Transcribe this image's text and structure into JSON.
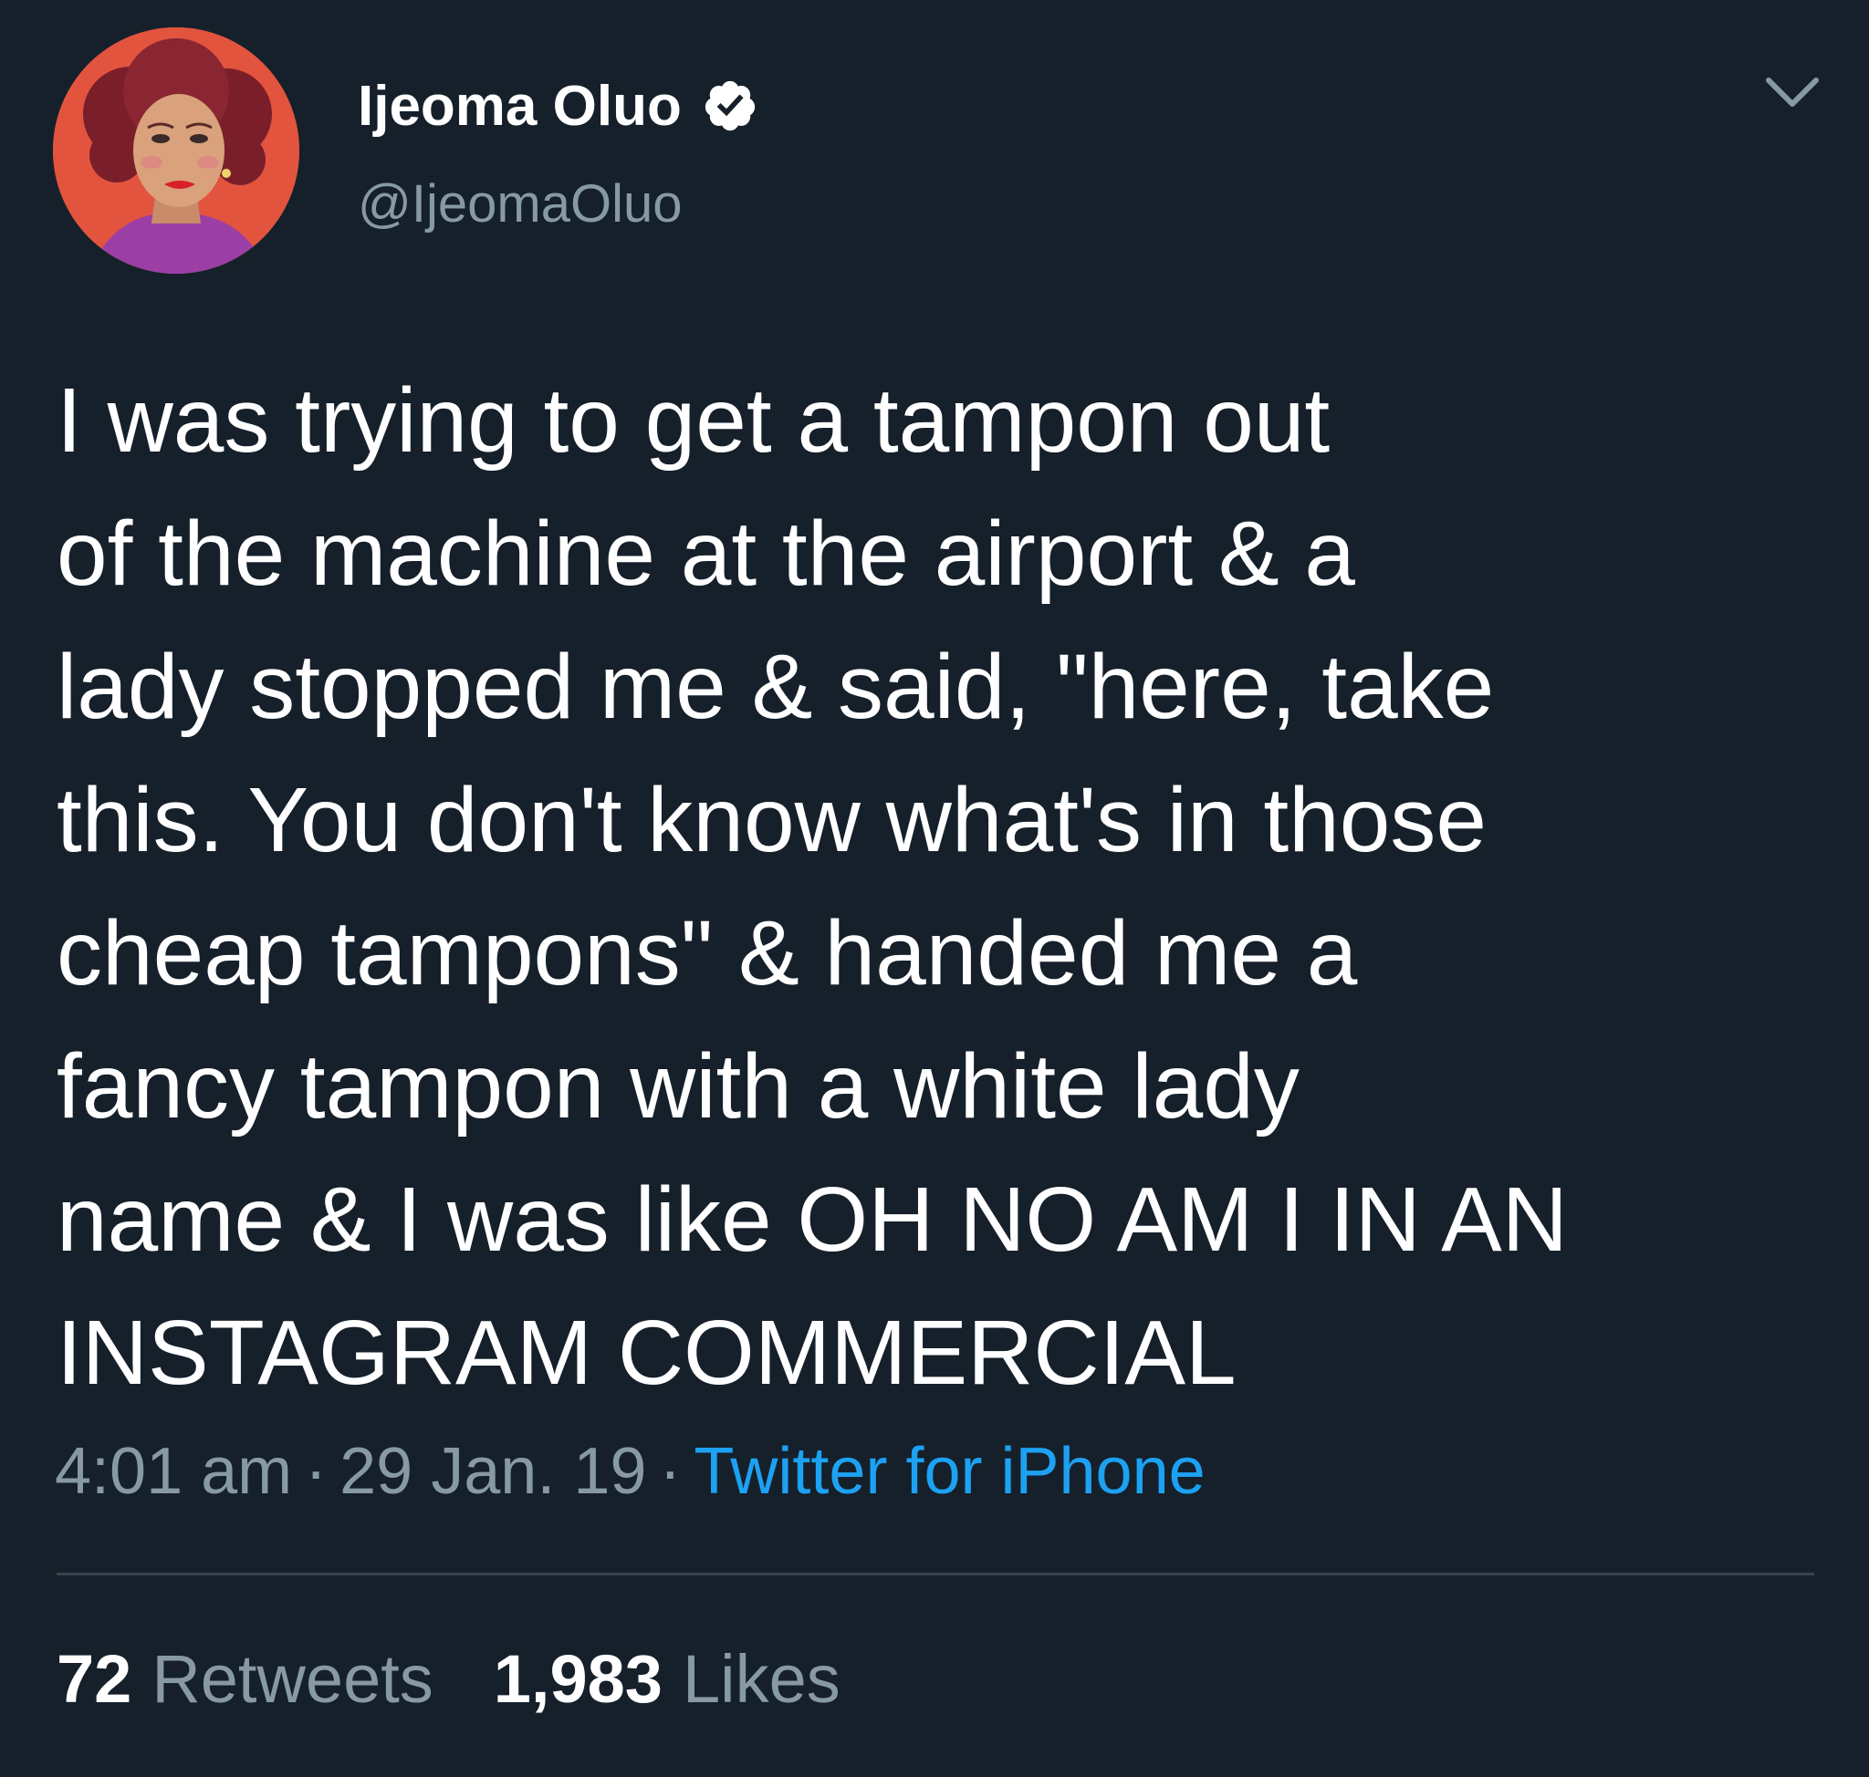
{
  "author": {
    "display_name": "Ijeoma Oluo",
    "handle": "@IjeomaOluo",
    "verified": true,
    "avatar_icon": "avatar-illustration"
  },
  "tweet": {
    "text_lines": [
      "I was trying to get a tampon out",
      "of the machine at the airport & a",
      "lady stopped me & said, \"here, take",
      "this. You don't know what's in those",
      "cheap tampons\" & handed me a",
      "fancy tampon with a white lady",
      "name & I was like OH NO AM I IN AN",
      "INSTAGRAM COMMERCIAL"
    ],
    "time": "4:01 am",
    "date": "29 Jan. 19",
    "separator": "·",
    "source": "Twitter for iPhone"
  },
  "stats": {
    "retweets_count": "72",
    "retweets_label": "Retweets",
    "likes_count": "1,983",
    "likes_label": "Likes"
  },
  "colors": {
    "background": "#15202b",
    "secondary_text": "#8899a6",
    "link": "#1da1f2",
    "divider": "#38444d"
  },
  "icons": {
    "verified": "verified-badge-icon",
    "menu": "chevron-down-icon"
  }
}
